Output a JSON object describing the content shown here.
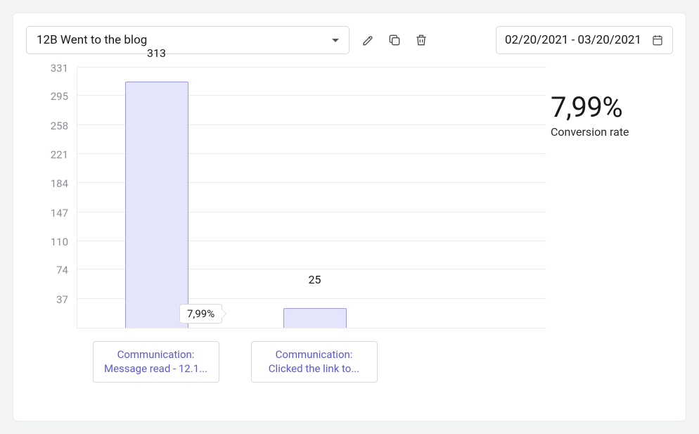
{
  "toolbar": {
    "funnel_select_value": "12B Went to the blog",
    "date_range": "02/20/2021 - 03/20/2021"
  },
  "kpi": {
    "value": "7,99%",
    "label": "Conversion rate"
  },
  "chart_data": {
    "type": "bar",
    "title": "",
    "xlabel": "",
    "ylabel": "",
    "ylim": [
      0,
      331
    ],
    "y_ticks": [
      37,
      74,
      110,
      147,
      184,
      221,
      258,
      295,
      331
    ],
    "categories": [
      "Communication: Message read - 12.1...",
      "Communication: Clicked the link to..."
    ],
    "values": [
      313,
      25
    ],
    "step_conversion_labels": [
      "7,99%"
    ]
  }
}
